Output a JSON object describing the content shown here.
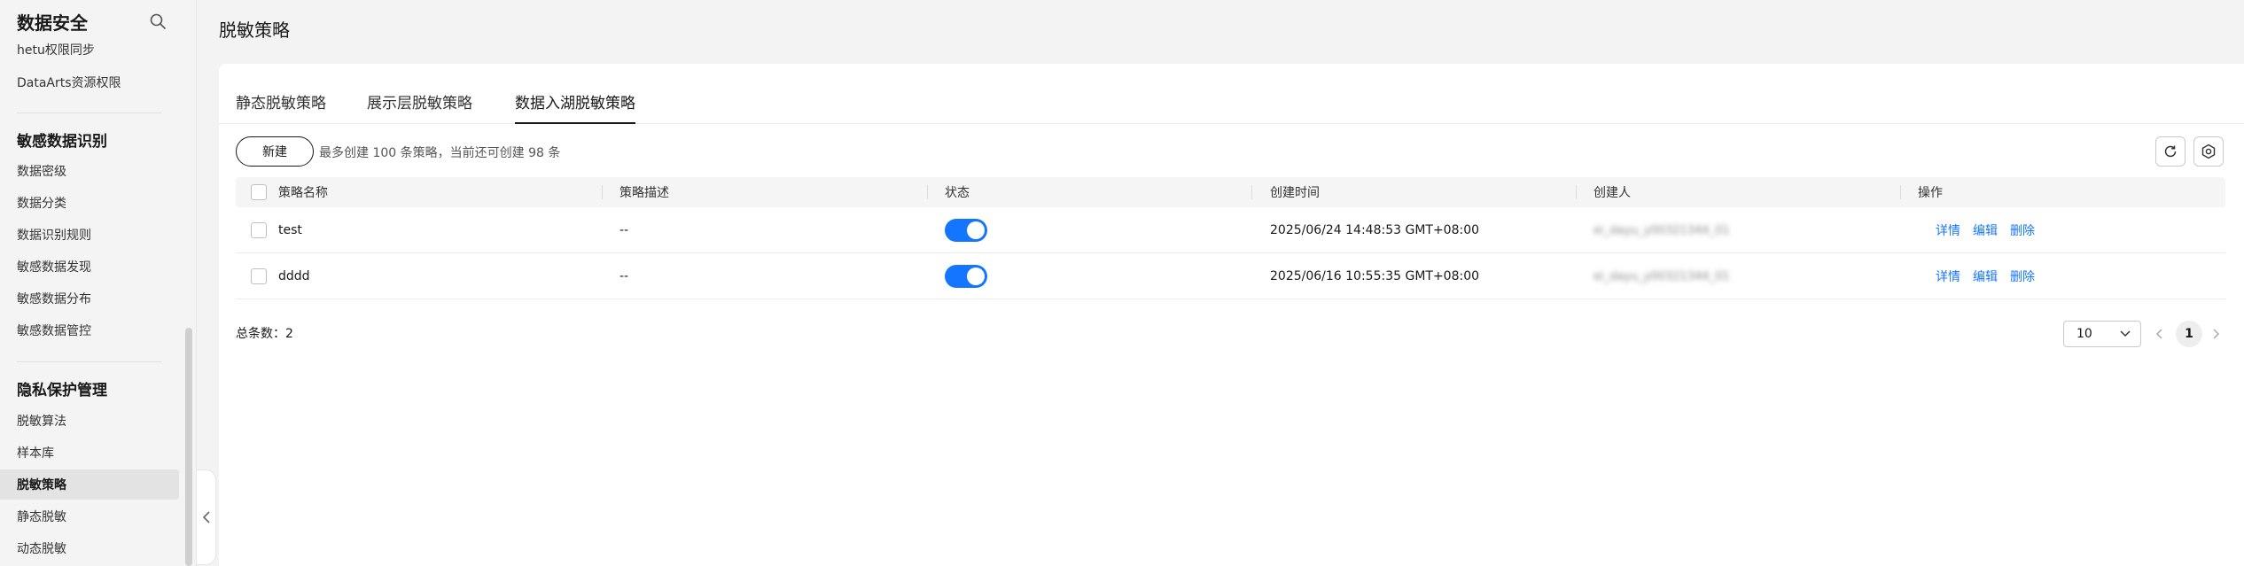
{
  "sidebar": {
    "title": "数据安全",
    "partial_top_item": "hetu权限同步",
    "items_top": [
      {
        "label": "DataArts资源权限"
      }
    ],
    "group_sensitive": {
      "title": "敏感数据识别",
      "items": [
        {
          "label": "数据密级"
        },
        {
          "label": "数据分类"
        },
        {
          "label": "数据识别规则"
        },
        {
          "label": "敏感数据发现"
        },
        {
          "label": "敏感数据分布"
        },
        {
          "label": "敏感数据管控"
        }
      ]
    },
    "group_privacy": {
      "title": "隐私保护管理",
      "items": [
        {
          "label": "脱敏算法"
        },
        {
          "label": "样本库"
        },
        {
          "label": "脱敏策略",
          "active": true
        },
        {
          "label": "静态脱敏"
        },
        {
          "label": "动态脱敏"
        }
      ]
    }
  },
  "page": {
    "title": "脱敏策略",
    "tabs": [
      {
        "label": "静态脱敏策略"
      },
      {
        "label": "展示层脱敏策略"
      },
      {
        "label": "数据入湖脱敏策略",
        "active": true
      }
    ]
  },
  "toolbar": {
    "new_label": "新建",
    "hint": "最多创建 100 条策略，当前还可创建 98 条"
  },
  "table": {
    "columns": [
      "策略名称",
      "策略描述",
      "状态",
      "创建时间",
      "创建人",
      "操作"
    ],
    "rows": [
      {
        "name": "test",
        "desc": "--",
        "enabled": true,
        "created": "2025/06/24 14:48:53 GMT+08:00",
        "creator": "ei_dayu_y00321344_01"
      },
      {
        "name": "dddd",
        "desc": "--",
        "enabled": true,
        "created": "2025/06/16 10:55:35 GMT+08:00",
        "creator": "ei_dayu_y00321344_01"
      }
    ],
    "actions": [
      "详情",
      "编辑",
      "删除"
    ]
  },
  "pagination": {
    "total_label": "总条数：",
    "total": "2",
    "page_size": "10",
    "current_page": "1"
  },
  "colors": {
    "accent": "#1476ff",
    "text": "#191919"
  }
}
